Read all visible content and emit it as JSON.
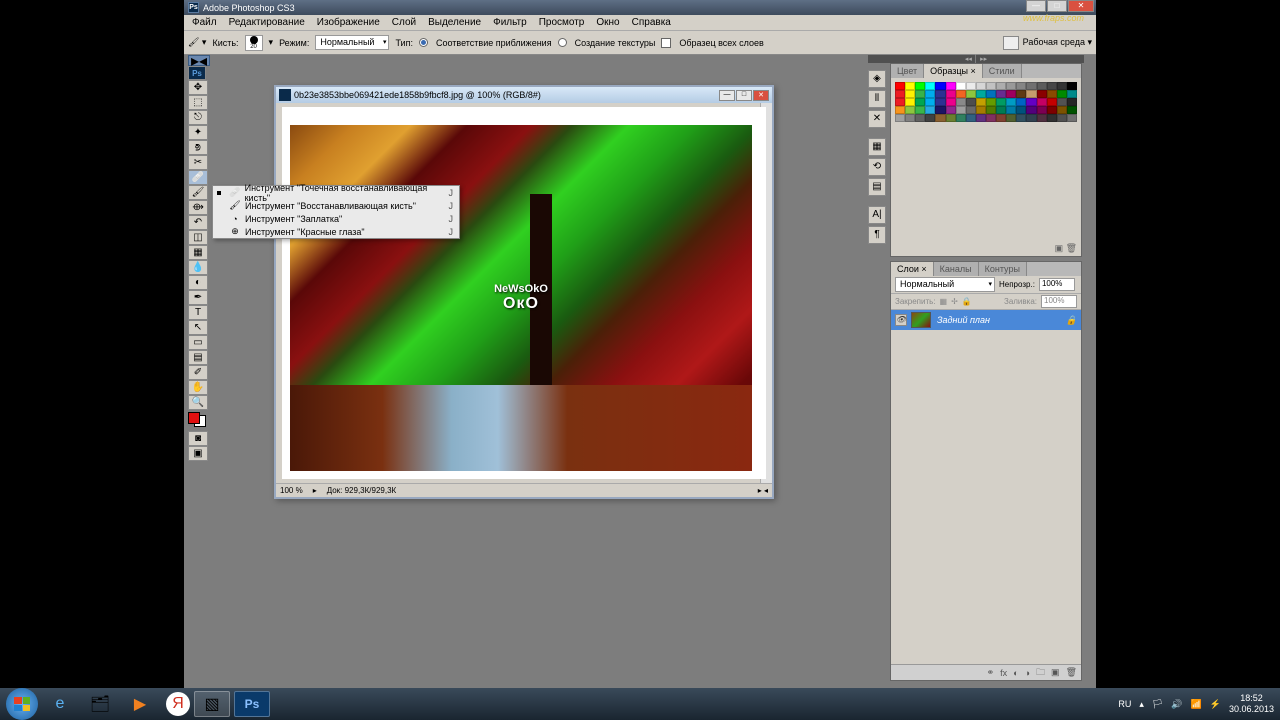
{
  "app": {
    "title": "Adobe Photoshop CS3",
    "watermark": "www.fraps.com"
  },
  "menu": [
    "Файл",
    "Редактирование",
    "Изображение",
    "Слой",
    "Выделение",
    "Фильтр",
    "Просмотр",
    "Окно",
    "Справка"
  ],
  "options": {
    "brush_label": "Кисть:",
    "brush_size": "20",
    "mode_label": "Режим:",
    "mode_value": "Нормальный",
    "type_label": "Тип:",
    "radio1": "Соответствие приближения",
    "radio2": "Создание текстуры",
    "sample_all": "Образец всех слоев",
    "workspace": "Рабочая среда ▾"
  },
  "tools_flyout": [
    {
      "label": "Инструмент \"Точечная восстанавливающая кисть\"",
      "key": "J",
      "active": true
    },
    {
      "label": "Инструмент \"Восстанавливающая кисть\"",
      "key": "J"
    },
    {
      "label": "Инструмент \"Заплатка\"",
      "key": "J"
    },
    {
      "label": "Инструмент \"Красные глаза\"",
      "key": "J"
    }
  ],
  "document": {
    "title": "0b23e3853bbe069421ede1858b9fbcf8.jpg @ 100% (RGB/8#)",
    "zoom": "100 %",
    "doc_size": "Док: 929,3К/929,3К",
    "watermark1": "NeWsOkO",
    "watermark2": "OкO"
  },
  "panels": {
    "color_tabs": [
      "Цвет",
      "Образцы ×",
      "Стили"
    ],
    "layers_tabs": [
      "Слои ×",
      "Каналы",
      "Контуры"
    ],
    "blend_mode": "Нормальный",
    "opacity_label": "Непрозр.:",
    "opacity": "100%",
    "lock_label": "Закрепить:",
    "fill_label": "Заливка:",
    "fill": "100%",
    "layer_name": "Задний план"
  },
  "swatches_colors": [
    "#ff0000",
    "#ffff00",
    "#00ff00",
    "#00ffff",
    "#0000ff",
    "#ff00ff",
    "#ffffff",
    "#ebebeb",
    "#d6d6d6",
    "#c2c2c2",
    "#adadad",
    "#999999",
    "#858585",
    "#707070",
    "#5c5c5c",
    "#474747",
    "#333333",
    "#000000",
    "#ec1c23",
    "#fef200",
    "#37b34a",
    "#00adee",
    "#2e3192",
    "#ec008c",
    "#f16522",
    "#8dc63f",
    "#00a99d",
    "#0072bc",
    "#662d91",
    "#9e005d",
    "#603913",
    "#c69c6d",
    "#8a0000",
    "#8a4a00",
    "#008a00",
    "#008a8a",
    "#ed1c24",
    "#fff200",
    "#00a651",
    "#00aeef",
    "#2e3192",
    "#ec008c",
    "#898989",
    "#4d4d4d",
    "#c4a000",
    "#639c00",
    "#009c63",
    "#009cc4",
    "#0063c4",
    "#6300c4",
    "#c40063",
    "#c40000",
    "#525252",
    "#262626",
    "#f7941d",
    "#8dc63f",
    "#39b54a",
    "#27aae1",
    "#1b1464",
    "#92278f",
    "#9e9e9e",
    "#696969",
    "#a67c00",
    "#527c00",
    "#007c52",
    "#007ca6",
    "#00527c",
    "#52007c",
    "#7c0052",
    "#7c0000",
    "#7c5200",
    "#005200",
    "#a0a0a0",
    "#808080",
    "#606060",
    "#404040",
    "#8a6030",
    "#6a8030",
    "#308060",
    "#306080",
    "#603080",
    "#803060",
    "#804030",
    "#506030",
    "#305060",
    "#304050",
    "#503040",
    "#303030",
    "#505050",
    "#707070"
  ],
  "taskbar": {
    "lang": "RU",
    "time": "18:52",
    "date": "30.06.2013"
  }
}
